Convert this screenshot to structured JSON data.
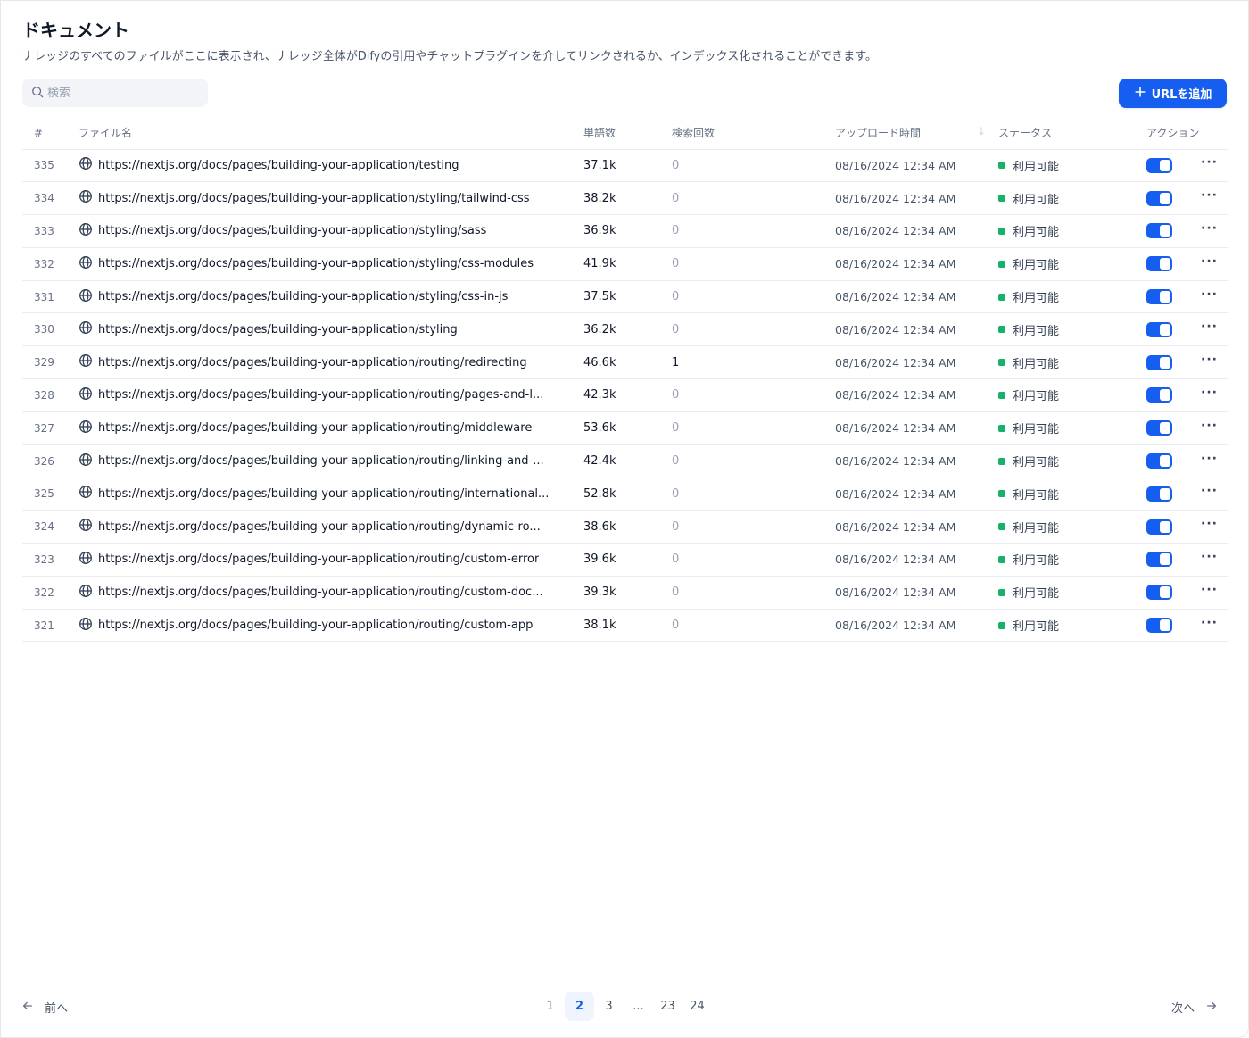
{
  "page": {
    "title": "ドキュメント",
    "description": "ナレッジのすべてのファイルがここに表示され、ナレッジ全体がDifyの引用やチャットプラグインを介してリンクされるか、インデックス化されることができます。"
  },
  "search": {
    "placeholder": "検索",
    "value": ""
  },
  "add_button": {
    "label": "URLを追加"
  },
  "table": {
    "headers": {
      "num": "#",
      "name": "ファイル名",
      "words": "単語数",
      "hits": "検索回数",
      "upload_time": "アップロード時間",
      "status": "ステータス",
      "actions": "アクション"
    },
    "rows": [
      {
        "num": "335",
        "name": "https://nextjs.org/docs/pages/building-your-application/testing",
        "words": "37.1k",
        "hits": "0",
        "time": "08/16/2024 12:34 AM",
        "status": "利用可能",
        "enabled": true
      },
      {
        "num": "334",
        "name": "https://nextjs.org/docs/pages/building-your-application/styling/tailwind-css",
        "words": "38.2k",
        "hits": "0",
        "time": "08/16/2024 12:34 AM",
        "status": "利用可能",
        "enabled": true
      },
      {
        "num": "333",
        "name": "https://nextjs.org/docs/pages/building-your-application/styling/sass",
        "words": "36.9k",
        "hits": "0",
        "time": "08/16/2024 12:34 AM",
        "status": "利用可能",
        "enabled": true
      },
      {
        "num": "332",
        "name": "https://nextjs.org/docs/pages/building-your-application/styling/css-modules",
        "words": "41.9k",
        "hits": "0",
        "time": "08/16/2024 12:34 AM",
        "status": "利用可能",
        "enabled": true
      },
      {
        "num": "331",
        "name": "https://nextjs.org/docs/pages/building-your-application/styling/css-in-js",
        "words": "37.5k",
        "hits": "0",
        "time": "08/16/2024 12:34 AM",
        "status": "利用可能",
        "enabled": true
      },
      {
        "num": "330",
        "name": "https://nextjs.org/docs/pages/building-your-application/styling",
        "words": "36.2k",
        "hits": "0",
        "time": "08/16/2024 12:34 AM",
        "status": "利用可能",
        "enabled": true
      },
      {
        "num": "329",
        "name": "https://nextjs.org/docs/pages/building-your-application/routing/redirecting",
        "words": "46.6k",
        "hits": "1",
        "time": "08/16/2024 12:34 AM",
        "status": "利用可能",
        "enabled": true
      },
      {
        "num": "328",
        "name": "https://nextjs.org/docs/pages/building-your-application/routing/pages-and-l...",
        "words": "42.3k",
        "hits": "0",
        "time": "08/16/2024 12:34 AM",
        "status": "利用可能",
        "enabled": true
      },
      {
        "num": "327",
        "name": "https://nextjs.org/docs/pages/building-your-application/routing/middleware",
        "words": "53.6k",
        "hits": "0",
        "time": "08/16/2024 12:34 AM",
        "status": "利用可能",
        "enabled": true
      },
      {
        "num": "326",
        "name": "https://nextjs.org/docs/pages/building-your-application/routing/linking-and-...",
        "words": "42.4k",
        "hits": "0",
        "time": "08/16/2024 12:34 AM",
        "status": "利用可能",
        "enabled": true
      },
      {
        "num": "325",
        "name": "https://nextjs.org/docs/pages/building-your-application/routing/international...",
        "words": "52.8k",
        "hits": "0",
        "time": "08/16/2024 12:34 AM",
        "status": "利用可能",
        "enabled": true
      },
      {
        "num": "324",
        "name": "https://nextjs.org/docs/pages/building-your-application/routing/dynamic-ro...",
        "words": "38.6k",
        "hits": "0",
        "time": "08/16/2024 12:34 AM",
        "status": "利用可能",
        "enabled": true
      },
      {
        "num": "323",
        "name": "https://nextjs.org/docs/pages/building-your-application/routing/custom-error",
        "words": "39.6k",
        "hits": "0",
        "time": "08/16/2024 12:34 AM",
        "status": "利用可能",
        "enabled": true
      },
      {
        "num": "322",
        "name": "https://nextjs.org/docs/pages/building-your-application/routing/custom-doc...",
        "words": "39.3k",
        "hits": "0",
        "time": "08/16/2024 12:34 AM",
        "status": "利用可能",
        "enabled": true
      },
      {
        "num": "321",
        "name": "https://nextjs.org/docs/pages/building-your-application/routing/custom-app",
        "words": "38.1k",
        "hits": "0",
        "time": "08/16/2024 12:34 AM",
        "status": "利用可能",
        "enabled": true
      }
    ]
  },
  "pagination": {
    "prev_label": "前へ",
    "next_label": "次へ",
    "pages": [
      "1",
      "2",
      "3",
      "...",
      "23",
      "24"
    ],
    "current": "2"
  },
  "colors": {
    "accent": "#155eef",
    "status_available": "#17b26a"
  },
  "icons": {
    "search": "search-icon",
    "add": "plus-icon",
    "file": "globe-icon",
    "sort": "arrow-down-icon",
    "more": "more-horizontal-icon",
    "prev": "arrow-left-icon",
    "next": "arrow-right-icon"
  }
}
